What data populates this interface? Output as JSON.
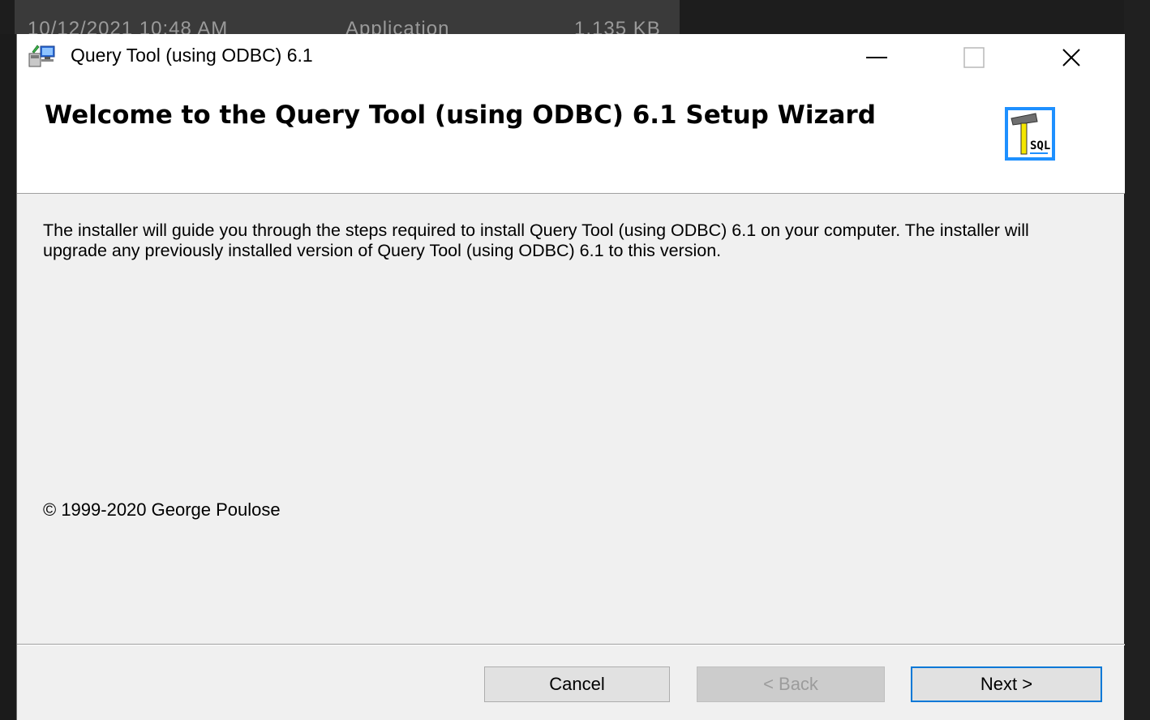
{
  "background": {
    "explorer_row": [
      "10/12/2021 10:48 AM",
      "Application",
      "1,135 KB"
    ]
  },
  "window": {
    "title": "Query Tool (using ODBC) 6.1",
    "controls": {
      "minimize_icon": "minimize-icon",
      "maximize_icon": "maximize-icon",
      "close_icon": "close-icon"
    }
  },
  "header": {
    "title": "Welcome to the Query Tool (using ODBC) 6.1 Setup Wizard",
    "logo_text": "SQL"
  },
  "body": {
    "description": "The installer will guide you through the steps required to install Query Tool (using ODBC) 6.1 on your computer. The installer will upgrade any previously installed version of Query Tool (using ODBC) 6.1 to this version.",
    "copyright": "© 1999-2020 George Poulose"
  },
  "footer": {
    "cancel_label": "Cancel",
    "back_label": "< Back",
    "next_label": "Next >"
  },
  "colors": {
    "accent": "#0078d7",
    "window_bg": "#f0f0f0",
    "header_bg": "#ffffff",
    "logo_blue": "#1e90ff",
    "logo_yellow": "#f5e600"
  }
}
